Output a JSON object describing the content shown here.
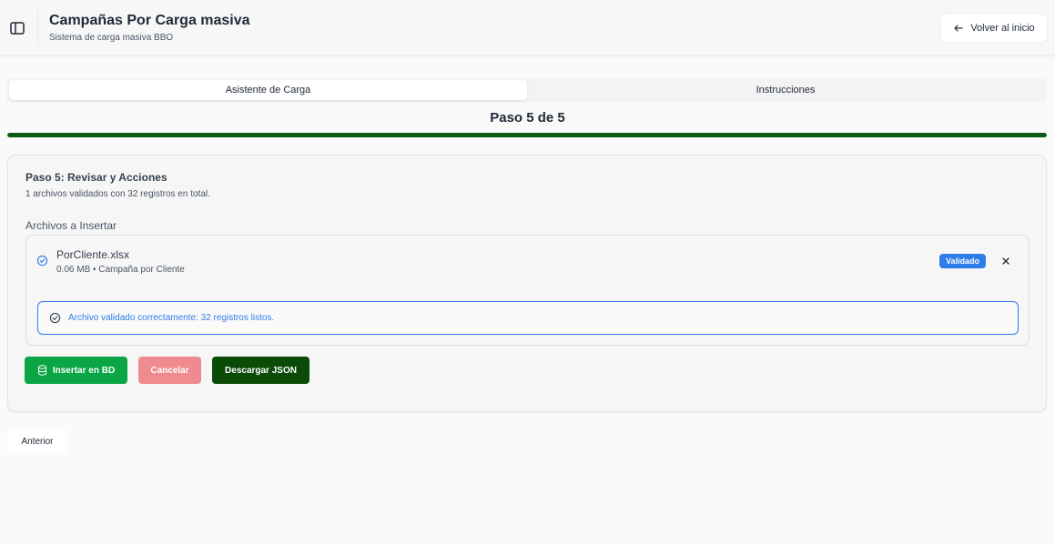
{
  "header": {
    "title": "Campañas Por Carga masiva",
    "subtitle": "Sistema de carga masiva BBO",
    "back_label": "Volver al inicio",
    "toggle_icon": "sidebar-panel-icon"
  },
  "tabs": [
    {
      "label": "Asistente de Carga",
      "active": true
    },
    {
      "label": "Instrucciones",
      "active": false
    }
  ],
  "progress": {
    "step_label": "Paso 5 de 5",
    "current": 5,
    "total": 5,
    "fraction": 1.0,
    "color": "#0a5c12"
  },
  "card": {
    "title": "Paso 5: Revisar y Acciones",
    "description": "1 archivos validados con 32 registros en total.",
    "section_label": "Archivos a Insertar"
  },
  "file": {
    "name": "PorCliente.xlsx",
    "meta": "0.06 MB • Campaña por Cliente",
    "badge": "Validado",
    "alert": "Archivo validado correctamente: 32 registros listos."
  },
  "actions": {
    "insert_label": "Insertar en BD",
    "cancel_label": "Cancelar",
    "download_label": "Descargar JSON",
    "previous_label": "Anterior"
  },
  "colors": {
    "accent_blue": "#2f7be8",
    "insert_green": "#0aa544",
    "cancel_red": "#ef8a8e",
    "download_green": "#0a4b08"
  }
}
